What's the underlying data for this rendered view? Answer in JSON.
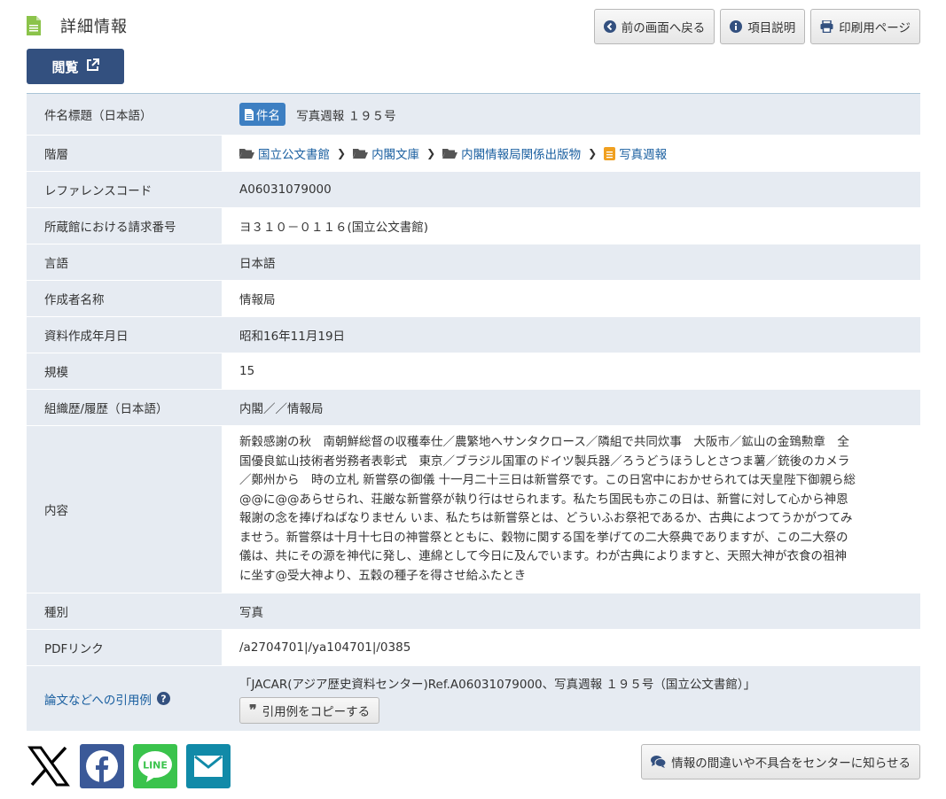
{
  "header": {
    "title": "詳細情報",
    "buttons": {
      "back": "前の画面へ戻る",
      "help": "項目説明",
      "print": "印刷用ページ"
    }
  },
  "view_button": "閲覧",
  "rows": {
    "title": {
      "label": "件名標題（日本語）",
      "badge": "件名",
      "value": "写真週報 １９５号"
    },
    "hierarchy": {
      "label": "階層",
      "items": [
        "国立公文書館",
        "内閣文庫",
        "内閣情報局関係出版物",
        "写真週報"
      ]
    },
    "refcode": {
      "label": "レファレンスコード",
      "value": "A06031079000"
    },
    "callno": {
      "label": "所蔵館における請求番号",
      "value": "ヨ３１０－０１１６(国立公文書館)"
    },
    "lang": {
      "label": "言語",
      "value": "日本語"
    },
    "creator": {
      "label": "作成者名称",
      "value": "情報局"
    },
    "date": {
      "label": "資料作成年月日",
      "value": "昭和16年11月19日"
    },
    "scale": {
      "label": "規模",
      "value": "15"
    },
    "org": {
      "label": "組織歴/履歴（日本語）",
      "value": "内閣／／情報局"
    },
    "content": {
      "label": "内容",
      "lines": [
        "新穀感謝の秋　南朝鮮総督の収穫奉仕／農繁地へサンタクロース／隣組で共同炊事　大阪市／鉱山の金鵄勲章　全",
        "国優良鉱山技術者労務者表彰式　東京／ブラジル国軍のドイツ製兵器／ろうどうほうしとさつま薯／銃後のカメラ",
        "／鄭州から　時の立札 新嘗祭の御儀 十一月二十三日は新嘗祭です。この日宮中におかせられては天皇陛下御親ら総",
        "@@に@@あらせられ、荘厳な新嘗祭が執り行はせられます。私たち国民も亦この日は、新嘗に対して心から神恩",
        "報謝の念を捧げねばなりません いま、私たちは新嘗祭とは、どういふお祭祀であるか、古典によつてうかがつてみ",
        "ませう。新嘗祭は十月十七日の神嘗祭とともに、穀物に関する国を挙げての二大祭典でありますが、この二大祭の",
        "儀は、共にその源を神代に発し、連綿として今日に及んでいます。わが古典によりますと、天照大神が衣食の祖神",
        "に坐す@受大神より、五穀の種子を得させ給ふたとき"
      ]
    },
    "kind": {
      "label": "種別",
      "value": "写真"
    },
    "pdf": {
      "label": "PDFリンク",
      "value": "/a2704701|/ya104701|/0385"
    },
    "cite": {
      "label": "論文などへの引用例",
      "value": "「JACAR(アジア歴史資料センター)Ref.A06031079000、写真週報 １９５号（国立公文書館）」",
      "copy_button": "引用例をコピーする"
    }
  },
  "report_button": "情報の間違いや不具合をセンターに知らせる",
  "share": [
    "x-icon",
    "facebook-icon",
    "line-icon",
    "mail-icon"
  ],
  "colors": {
    "accent": "#33507f",
    "link": "#1a5fa0",
    "row": "#e6ebf2",
    "badge": "#3d7fc2",
    "facebook": "#3b5998",
    "line": "#3ac34c",
    "mail": "#118aa8"
  }
}
